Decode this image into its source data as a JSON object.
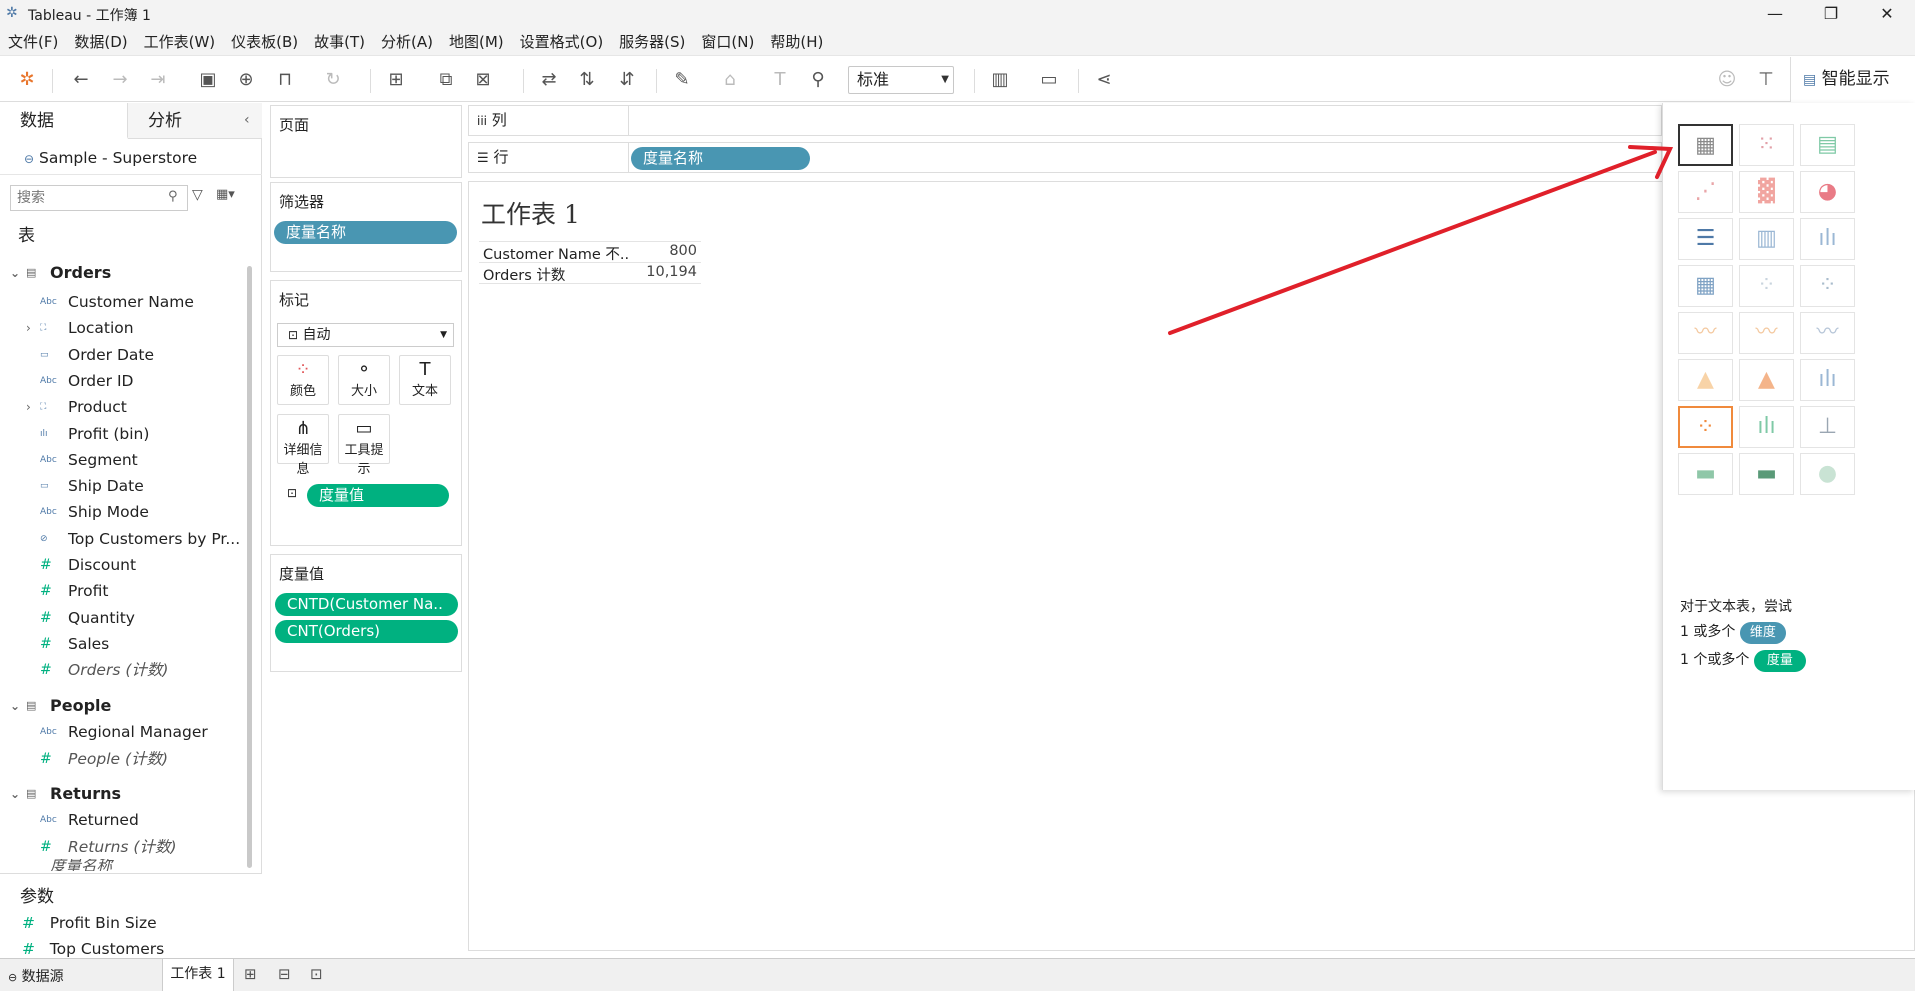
{
  "window": {
    "title": "Tableau - 工作簿 1",
    "controls": [
      "—",
      "❐",
      "✕"
    ]
  },
  "menu": [
    "文件(F)",
    "数据(D)",
    "工作表(W)",
    "仪表板(B)",
    "故事(T)",
    "分析(A)",
    "地图(M)",
    "设置格式(O)",
    "服务器(S)",
    "窗口(N)",
    "帮助(H)"
  ],
  "toolbar": {
    "fit": "标准",
    "showme_label": "智能显示"
  },
  "left": {
    "tab_data": "数据",
    "tab_analysis": "分析",
    "datasource": "Sample - Superstore",
    "search_placeholder": "搜索",
    "tables_heading": "表",
    "orders": {
      "name": "Orders",
      "fields": [
        "Customer Name",
        "Location",
        "Order Date",
        "Order ID",
        "Product",
        "Profit (bin)",
        "Segment",
        "Ship Date",
        "Ship Mode",
        "Top Customers by Pr...",
        "Discount",
        "Profit",
        "Quantity",
        "Sales",
        "Orders (计数)"
      ]
    },
    "people": {
      "name": "People",
      "fields": [
        "Regional Manager",
        "People (计数)"
      ]
    },
    "returns": {
      "name": "Returns",
      "fields": [
        "Returned",
        "Returns (计数)"
      ]
    },
    "cut_field": "度量名称",
    "params_heading": "参数",
    "params": [
      "Profit Bin Size",
      "Top Customers"
    ]
  },
  "shelves": {
    "pages": "页面",
    "filters": "筛选器",
    "filter_pill": "度量名称",
    "marks": "标记",
    "mark_type": "自动",
    "buttons": [
      "颜色",
      "大小",
      "文本",
      "详细信息",
      "工具提示"
    ],
    "mark_pill": "度量值",
    "measure_values_title": "度量值",
    "mv_pills": [
      "CNTD(Customer Na..",
      "CNT(Orders)"
    ],
    "columns": "列",
    "rows": "行",
    "rows_pill": "度量名称"
  },
  "sheet": {
    "title": "工作表 1",
    "table": [
      {
        "label": "Customer Name 不..",
        "value": "800"
      },
      {
        "label": "Orders 计数",
        "value": "10,194"
      }
    ]
  },
  "showme": {
    "hint": "对于文本表，尝试",
    "dim_prefix": "1 或多个",
    "dim_badge": "维度",
    "meas_prefix": "1 个或多个",
    "meas_badge": "度量"
  },
  "status": {
    "datasource_tab": "数据源",
    "sheet_tab": "工作表 1"
  },
  "colors": {
    "dimension": "#4996b2",
    "measure": "#00b180",
    "arrow": "#e0202a",
    "selected": "#f08a3c"
  }
}
